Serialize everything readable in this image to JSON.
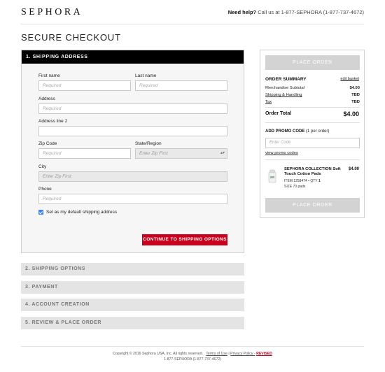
{
  "header": {
    "logo": "SEPHORA",
    "help_label": "Need help?",
    "help_text": "Call us at 1-877-SEPHORA (1-877-737-4672)"
  },
  "page_title": "SECURE CHECKOUT",
  "shipping": {
    "heading": "1. SHIPPING ADDRESS",
    "first_name_label": "First name",
    "first_name_placeholder": "Required",
    "last_name_label": "Last name",
    "last_name_placeholder": "Required",
    "address_label": "Address",
    "address_placeholder": "Required",
    "address2_label": "Address line 2",
    "address2_placeholder": "",
    "zip_label": "Zip Code",
    "zip_placeholder": "Required",
    "state_label": "State/Region",
    "state_value": "Enter Zip First",
    "city_label": "City",
    "city_value": "Enter Zip First",
    "phone_label": "Phone",
    "phone_placeholder": "Required",
    "default_checkbox_label": "Set as my default shipping address",
    "default_checked": true,
    "continue_label": "CONTINUE TO SHIPPING OPTIONS"
  },
  "steps": [
    "2. SHIPPING OPTIONS",
    "3. PAYMENT",
    "4. ACCOUNT CREATION",
    "5. REVIEW & PLACE ORDER"
  ],
  "summary": {
    "place_order_label": "PLACE ORDER",
    "title": "ORDER SUMMARY",
    "edit_link": "edit basket",
    "rows": [
      {
        "label": "Merchandise Subtotal",
        "value": "$4.00"
      },
      {
        "label": "Shipping & Handling",
        "value": "TBD"
      },
      {
        "label": "Tax",
        "value": "TBD"
      }
    ],
    "total_label": "Order Total",
    "total_value": "$4.00",
    "promo_title": "ADD PROMO CODE",
    "promo_note": "(1 per order)",
    "promo_placeholder": "Enter Code",
    "promo_link": "view promo codes"
  },
  "product": {
    "name": "SEPHORA COLLECTION Soft Touch Cotton Pads",
    "price": "$4.00",
    "item_label": "ITEM 1258474",
    "qty_label": "QTY",
    "qty": "1",
    "size": "SIZE 70 pads"
  },
  "footer": {
    "copyright": "Copyright © 2016 Sephora USA, Inc. All rights reserved.",
    "terms": "Terms of Use",
    "sep": "|",
    "privacy": "Privacy Policy -",
    "revised": "REVISED",
    "phone": "1-877-SEPHORA (1-877-737-4672)"
  },
  "colors": {
    "accent_red": "#c8001c",
    "panel_header": "#000000",
    "disabled_button": "#d3d3d3"
  }
}
